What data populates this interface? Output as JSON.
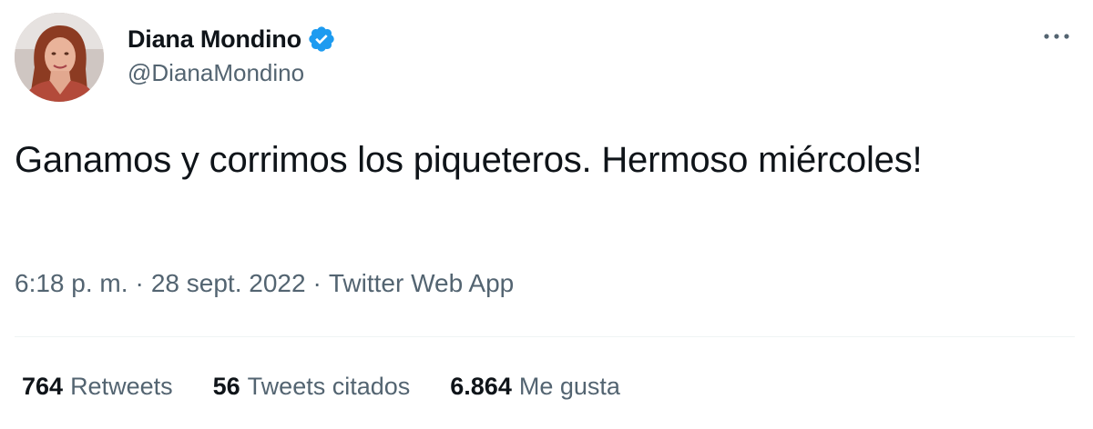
{
  "author": {
    "display_name": "Diana Mondino",
    "handle": "@DianaMondino",
    "verified_icon": "verified-badge-icon",
    "verified_color": "#1d9bf0"
  },
  "tweet": {
    "text": "Ganamos y corrimos los piqueteros. Hermoso miércoles!",
    "time": "6:18 p. m.",
    "date": "28 sept. 2022",
    "source": "Twitter Web App",
    "separator": "·"
  },
  "stats": [
    {
      "count": "764",
      "label": "Retweets"
    },
    {
      "count": "56",
      "label": "Tweets citados"
    },
    {
      "count": "6.864",
      "label": "Me gusta"
    }
  ],
  "menu_icon": "more-horizontal-icon"
}
